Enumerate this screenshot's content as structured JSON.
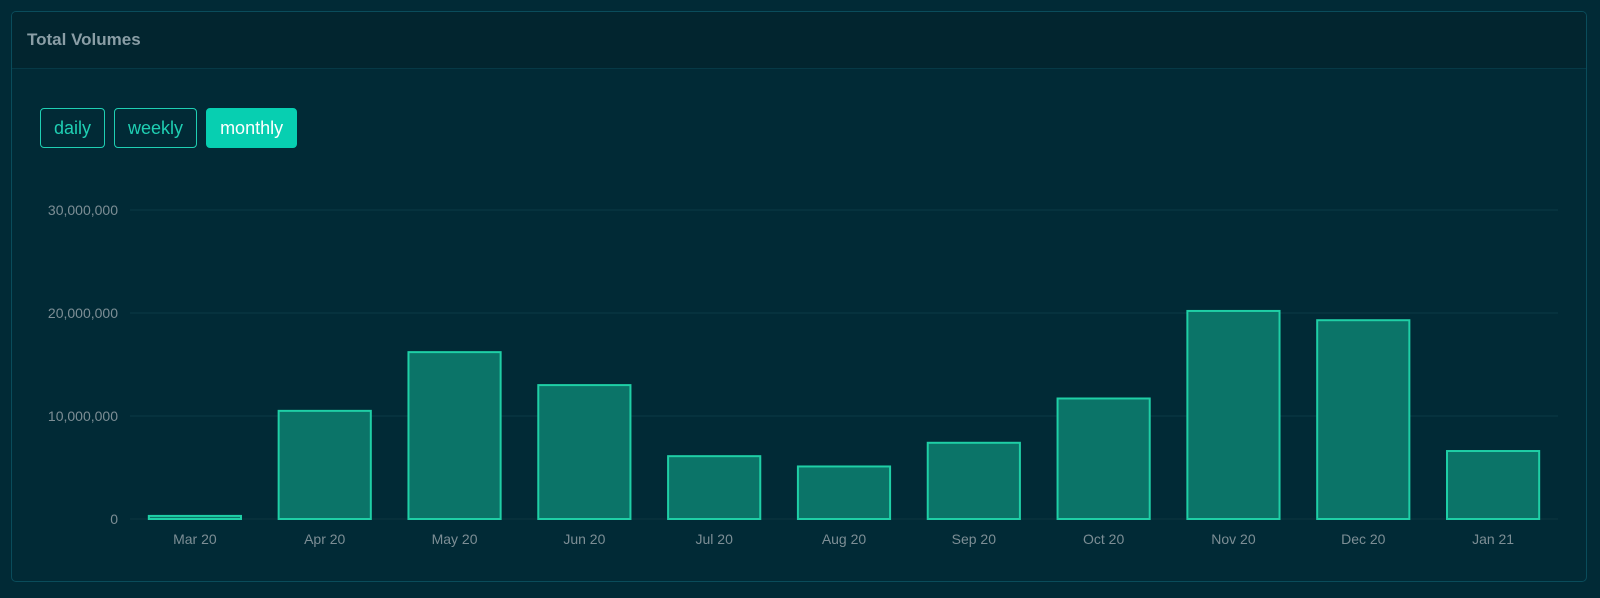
{
  "card": {
    "title": "Total Volumes"
  },
  "buttons": [
    {
      "label": "daily",
      "active": false
    },
    {
      "label": "weekly",
      "active": false
    },
    {
      "label": "monthly",
      "active": true
    }
  ],
  "colors": {
    "bar_fill": "#0b7468",
    "bar_stroke": "#1fcfa6",
    "accent": "#07cfb1"
  },
  "chart_data": {
    "type": "bar",
    "title": "",
    "xlabel": "",
    "ylabel": "",
    "categories": [
      "Mar 20",
      "Apr 20",
      "May 20",
      "Jun 20",
      "Jul 20",
      "Aug 20",
      "Sep 20",
      "Oct 20",
      "Nov 20",
      "Dec 20",
      "Jan 21"
    ],
    "values": [
      300000,
      10500000,
      16200000,
      13000000,
      6100000,
      5100000,
      7400000,
      11700000,
      20200000,
      19300000,
      6600000
    ],
    "ylim": [
      0,
      30000000
    ],
    "yticks": [
      0,
      10000000,
      20000000,
      30000000
    ],
    "ytick_labels": [
      "0",
      "10,000,000",
      "20,000,000",
      "30,000,000"
    ],
    "grid": true,
    "legend": false
  }
}
